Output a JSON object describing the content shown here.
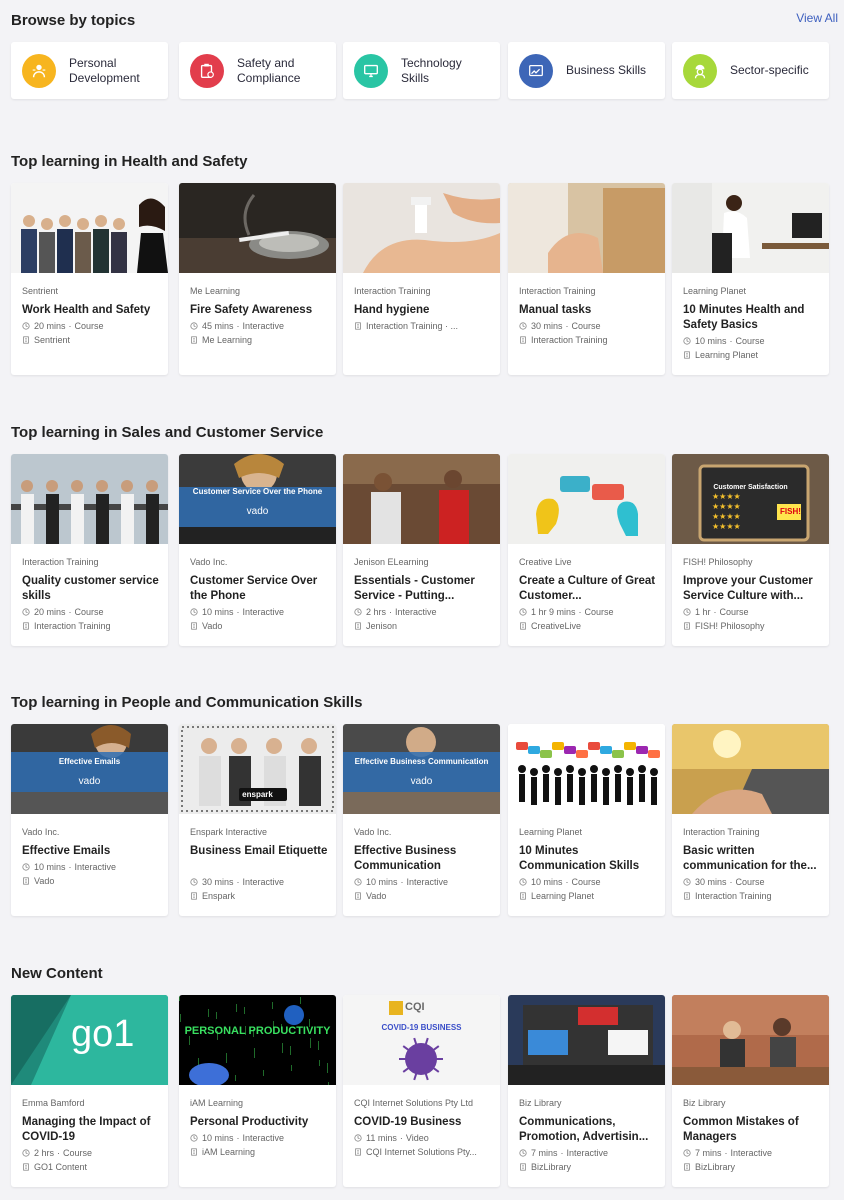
{
  "browse": {
    "title": "Browse by topics",
    "view_all": "View All",
    "topics": [
      {
        "label": "Personal Development",
        "icon": "person-icon",
        "color": "#f7b51f"
      },
      {
        "label": "Safety and Compliance",
        "icon": "clipboard-icon",
        "color": "#e23d4c"
      },
      {
        "label": "Technology Skills",
        "icon": "monitor-icon",
        "color": "#29c5a4"
      },
      {
        "label": "Business Skills",
        "icon": "chart-icon",
        "color": "#3d66b7"
      },
      {
        "label": "Sector-specific",
        "icon": "worker-icon",
        "color": "#a7d83a"
      }
    ]
  },
  "sections": [
    {
      "title": "Top learning in Health and Safety",
      "cards": [
        {
          "provider": "Sentrient",
          "title": "Work Health and Safety",
          "duration": "20 mins",
          "type": "Course",
          "source": "Sentrient"
        },
        {
          "provider": "Me Learning",
          "title": "Fire Safety Awareness",
          "duration": "45 mins",
          "type": "Interactive",
          "source": "Me Learning"
        },
        {
          "provider": "Interaction Training",
          "title": "Hand hygiene",
          "duration": "",
          "type": "",
          "source": "Interaction Training · ..."
        },
        {
          "provider": "Interaction Training",
          "title": "Manual tasks",
          "duration": "30 mins",
          "type": "Course",
          "source": "Interaction Training"
        },
        {
          "provider": "Learning Planet",
          "title": "10 Minutes Health and Safety Basics",
          "duration": "10 mins",
          "type": "Course",
          "source": "Learning Planet"
        }
      ]
    },
    {
      "title": "Top learning in Sales and Customer Service",
      "cards": [
        {
          "provider": "Interaction Training",
          "title": "Quality customer service skills",
          "duration": "20 mins",
          "type": "Course",
          "source": "Interaction Training"
        },
        {
          "provider": "Vado Inc.",
          "title": "Customer Service Over the Phone",
          "duration": "10 mins",
          "type": "Interactive",
          "source": "Vado",
          "overlay": "Customer Service Over the Phone",
          "overlay_logo": "vado"
        },
        {
          "provider": "Jenison ELearning",
          "title": "Essentials - Customer Service - Putting...",
          "duration": "2 hrs",
          "type": "Interactive",
          "source": "Jenison"
        },
        {
          "provider": "Creative Live",
          "title": "Create a Culture of Great Customer...",
          "duration": "1 hr 9 mins",
          "type": "Course",
          "source": "CreativeLive"
        },
        {
          "provider": "FISH! Philosophy",
          "title": "Improve your Customer Service Culture with...",
          "duration": "1 hr",
          "type": "Course",
          "source": "FISH! Philosophy",
          "overlay": "Customer Satisfaction",
          "overlay_logo": "FISH!"
        }
      ]
    },
    {
      "title": "Top learning in People and Communication Skills",
      "cards": [
        {
          "provider": "Vado Inc.",
          "title": "Effective Emails",
          "duration": "10 mins",
          "type": "Interactive",
          "source": "Vado",
          "overlay": "Effective Emails",
          "overlay_logo": "vado"
        },
        {
          "provider": "Enspark Interactive",
          "title": "Business Email Etiquette",
          "duration": "30 mins",
          "type": "Interactive",
          "source": "Enspark",
          "overlay_logo": "enspark"
        },
        {
          "provider": "Vado Inc.",
          "title": "Effective Business Communication",
          "duration": "10 mins",
          "type": "Interactive",
          "source": "Vado",
          "overlay": "Effective Business Communication",
          "overlay_logo": "vado"
        },
        {
          "provider": "Learning Planet",
          "title": "10 Minutes Communication Skills",
          "duration": "10 mins",
          "type": "Course",
          "source": "Learning Planet"
        },
        {
          "provider": "Interaction Training",
          "title": "Basic written communication for the...",
          "duration": "30 mins",
          "type": "Course",
          "source": "Interaction Training"
        }
      ]
    },
    {
      "title": "New Content",
      "cards": [
        {
          "provider": "Emma Bamford",
          "title": "Managing the Impact of COVID-19",
          "duration": "2 hrs",
          "type": "Course",
          "source": "GO1 Content",
          "overlay_logo": "go1"
        },
        {
          "provider": "iAM Learning",
          "title": "Personal Productivity",
          "duration": "10 mins",
          "type": "Interactive",
          "source": "iAM Learning",
          "overlay": "PERSONAL PRODUCTIVITY"
        },
        {
          "provider": "CQI Internet Solutions Pty Ltd",
          "title": "COVID-19 Business",
          "duration": "11 mins",
          "type": "Video",
          "source": "CQI Internet Solutions Pty...",
          "overlay": "COVID-19 BUSINESS",
          "overlay_logo": "CQI"
        },
        {
          "provider": "Biz Library",
          "title": "Communications, Promotion, Advertisin...",
          "duration": "7 mins",
          "type": "Interactive",
          "source": "BizLibrary"
        },
        {
          "provider": "Biz Library",
          "title": "Common Mistakes of Managers",
          "duration": "7 mins",
          "type": "Interactive",
          "source": "BizLibrary"
        }
      ]
    }
  ]
}
